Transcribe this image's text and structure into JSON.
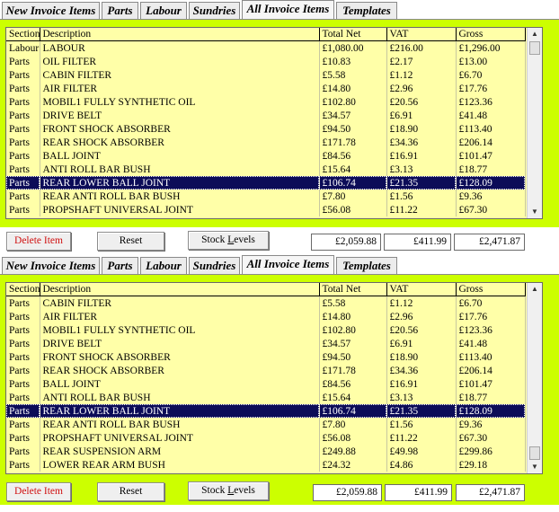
{
  "tabs": [
    "New Invoice Items",
    "Parts",
    "Labour",
    "Sundries",
    "All Invoice Items",
    "Templates"
  ],
  "active_tab": "All Invoice Items",
  "columns": [
    "Section",
    "Description",
    "Total Net",
    "VAT",
    "Gross"
  ],
  "panel1": {
    "rows": [
      [
        "Labour",
        "LABOUR",
        "£1,080.00",
        "£216.00",
        "£1,296.00"
      ],
      [
        "Parts",
        "OIL FILTER",
        "£10.83",
        "£2.17",
        "£13.00"
      ],
      [
        "Parts",
        "CABIN FILTER",
        "£5.58",
        "£1.12",
        "£6.70"
      ],
      [
        "Parts",
        "AIR FILTER",
        "£14.80",
        "£2.96",
        "£17.76"
      ],
      [
        "Parts",
        "MOBIL1 FULLY SYNTHETIC OIL",
        "£102.80",
        "£20.56",
        "£123.36"
      ],
      [
        "Parts",
        "DRIVE BELT",
        "£34.57",
        "£6.91",
        "£41.48"
      ],
      [
        "Parts",
        "FRONT SHOCK ABSORBER",
        "£94.50",
        "£18.90",
        "£113.40"
      ],
      [
        "Parts",
        "REAR SHOCK ABSORBER",
        "£171.78",
        "£34.36",
        "£206.14"
      ],
      [
        "Parts",
        "BALL JOINT",
        "£84.56",
        "£16.91",
        "£101.47"
      ],
      [
        "Parts",
        "ANTI ROLL BAR BUSH",
        "£15.64",
        "£3.13",
        "£18.77"
      ],
      [
        "Parts",
        "REAR LOWER BALL JOINT",
        "£106.74",
        "£21.35",
        "£128.09"
      ],
      [
        "Parts",
        "REAR ANTI ROLL BAR BUSH",
        "£7.80",
        "£1.56",
        "£9.36"
      ],
      [
        "Parts",
        "PROPSHAFT UNIVERSAL JOINT",
        "£56.08",
        "£11.22",
        "£67.30"
      ]
    ],
    "selected_row": 10,
    "scroll_fraction": 0.0
  },
  "panel2": {
    "rows": [
      [
        "Parts",
        "CABIN FILTER",
        "£5.58",
        "£1.12",
        "£6.70"
      ],
      [
        "Parts",
        "AIR FILTER",
        "£14.80",
        "£2.96",
        "£17.76"
      ],
      [
        "Parts",
        "MOBIL1 FULLY SYNTHETIC OIL",
        "£102.80",
        "£20.56",
        "£123.36"
      ],
      [
        "Parts",
        "DRIVE BELT",
        "£34.57",
        "£6.91",
        "£41.48"
      ],
      [
        "Parts",
        "FRONT SHOCK ABSORBER",
        "£94.50",
        "£18.90",
        "£113.40"
      ],
      [
        "Parts",
        "REAR SHOCK ABSORBER",
        "£171.78",
        "£34.36",
        "£206.14"
      ],
      [
        "Parts",
        "BALL JOINT",
        "£84.56",
        "£16.91",
        "£101.47"
      ],
      [
        "Parts",
        "ANTI ROLL BAR BUSH",
        "£15.64",
        "£3.13",
        "£18.77"
      ],
      [
        "Parts",
        "REAR LOWER BALL JOINT",
        "£106.74",
        "£21.35",
        "£128.09"
      ],
      [
        "Parts",
        "REAR ANTI ROLL BAR BUSH",
        "£7.80",
        "£1.56",
        "£9.36"
      ],
      [
        "Parts",
        "PROPSHAFT UNIVERSAL JOINT",
        "£56.08",
        "£11.22",
        "£67.30"
      ],
      [
        "Parts",
        "REAR SUSPENSION ARM",
        "£249.88",
        "£49.98",
        "£299.86"
      ],
      [
        "Parts",
        "LOWER REAR ARM BUSH",
        "£24.32",
        "£4.86",
        "£29.18"
      ]
    ],
    "selected_row": 8,
    "scroll_fraction": 1.0
  },
  "buttons": {
    "delete": "Delete Item",
    "reset": "Reset",
    "stock": "Stock Levels"
  },
  "totals": {
    "net": "£2,059.88",
    "vat": "£411.99",
    "gross": "£2,471.87"
  },
  "colors": {
    "panel_bg": "#ccff00",
    "list_bg": "#ffffa8",
    "selection": "#0c0c58",
    "danger": "#d01010"
  },
  "icons": {
    "scroll_up": "arrow-up-icon",
    "scroll_down": "arrow-down-icon"
  }
}
